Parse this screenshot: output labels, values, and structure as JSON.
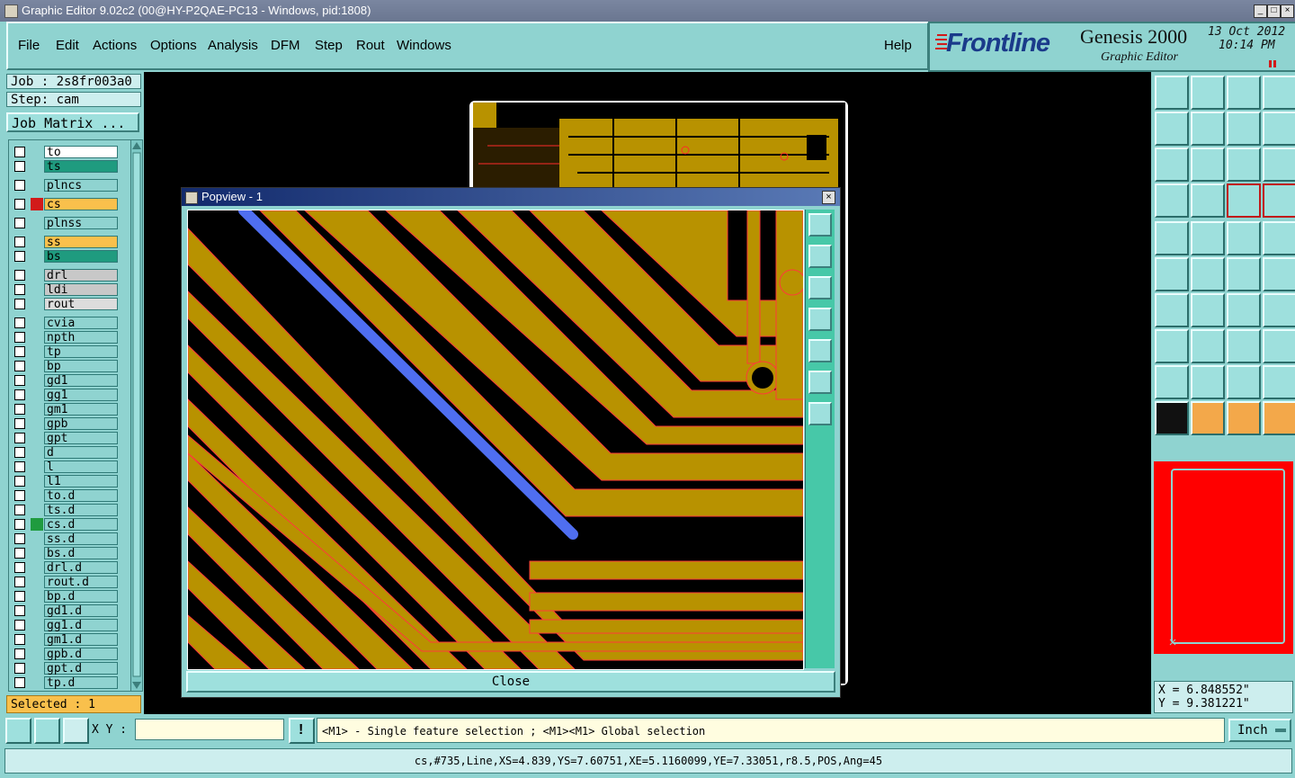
{
  "window": {
    "title": "Graphic Editor 9.02c2 (00@HY-P2QAE-PC13 - Windows, pid:1808)"
  },
  "menu": [
    "File",
    "Edit",
    "Actions",
    "Options",
    "Analysis",
    "DFM",
    "Step",
    "Rout",
    "Windows"
  ],
  "help_label": "Help",
  "brand": {
    "logo": "Frontline",
    "product": "Genesis 2000",
    "subtitle": "Graphic Editor",
    "date": "13 Oct 2012",
    "time": "10:14 PM"
  },
  "job": {
    "job_line": "Job : 2s8fr003a0",
    "step_line": "Step: cam",
    "matrix_label": "Job Matrix ..."
  },
  "layers": [
    {
      "name": "to",
      "color": "#ffffff"
    },
    {
      "name": "ts",
      "color": "#1f9b7f"
    },
    {
      "name": "plncs",
      "color": "#8fd3d0"
    },
    {
      "name": "cs",
      "color": "#f9c04c"
    },
    {
      "name": "plnss",
      "color": "#8fd3d0"
    },
    {
      "name": "ss",
      "color": "#f9c04c"
    },
    {
      "name": "bs",
      "color": "#1f9b7f"
    },
    {
      "name": "drl",
      "color": "#c8c8c8"
    },
    {
      "name": "ldi",
      "color": "#c8c8c8"
    },
    {
      "name": "rout",
      "color": "#dcdcdc"
    },
    {
      "name": "cvia",
      "color": "#8fd3d0"
    },
    {
      "name": "npth",
      "color": "#8fd3d0"
    },
    {
      "name": "tp",
      "color": "#8fd3d0"
    },
    {
      "name": "bp",
      "color": "#8fd3d0"
    },
    {
      "name": "gd1",
      "color": "#8fd3d0"
    },
    {
      "name": "gg1",
      "color": "#8fd3d0"
    },
    {
      "name": "gm1",
      "color": "#8fd3d0"
    },
    {
      "name": "gpb",
      "color": "#8fd3d0"
    },
    {
      "name": "gpt",
      "color": "#8fd3d0"
    },
    {
      "name": "d",
      "color": "#8fd3d0"
    },
    {
      "name": "l",
      "color": "#8fd3d0"
    },
    {
      "name": "l1",
      "color": "#8fd3d0"
    },
    {
      "name": "to.d",
      "color": "#8fd3d0"
    },
    {
      "name": "ts.d",
      "color": "#8fd3d0"
    },
    {
      "name": "cs.d",
      "color": "#8fd3d0"
    },
    {
      "name": "ss.d",
      "color": "#8fd3d0"
    },
    {
      "name": "bs.d",
      "color": "#8fd3d0"
    },
    {
      "name": "drl.d",
      "color": "#8fd3d0"
    },
    {
      "name": "rout.d",
      "color": "#8fd3d0"
    },
    {
      "name": "bp.d",
      "color": "#8fd3d0"
    },
    {
      "name": "gd1.d",
      "color": "#8fd3d0"
    },
    {
      "name": "gg1.d",
      "color": "#8fd3d0"
    },
    {
      "name": "gm1.d",
      "color": "#8fd3d0"
    },
    {
      "name": "gpb.d",
      "color": "#8fd3d0"
    },
    {
      "name": "gpt.d",
      "color": "#8fd3d0"
    },
    {
      "name": "tp.d",
      "color": "#8fd3d0"
    }
  ],
  "selected_label": "Selected : 1",
  "popview": {
    "title": "Popview - 1",
    "close_label": "Close"
  },
  "coords": {
    "x_line": "X = 6.848552\"",
    "y_line": "Y = 9.381221\""
  },
  "bottom": {
    "xy_label": "X Y :",
    "xy_value": "",
    "hint": "<M1> - Single feature selection ; <M1><M1> Global selection",
    "units": "Inch"
  },
  "status_text": "cs,#735,Line,XS=4.839,YS=7.60751,XE=5.1160099,YE=7.33051,r8.5,POS,Ang=45",
  "colors": {
    "copper": "#b89200",
    "highlight": "#4f6ef0",
    "panel": "#8fd3d0"
  }
}
